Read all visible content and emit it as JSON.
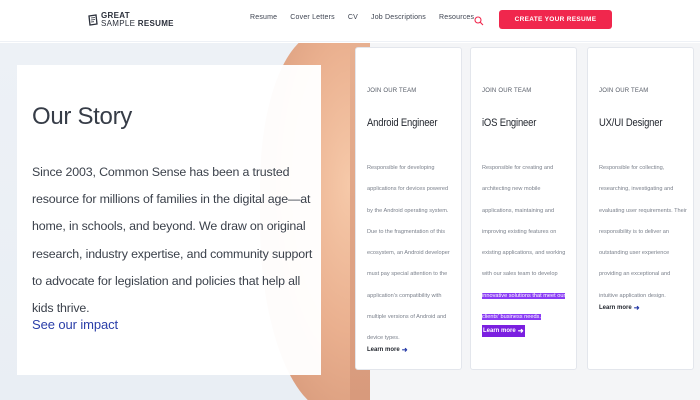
{
  "header": {
    "logo": {
      "line1": "GREAT",
      "line2_a": "SAMPLE ",
      "line2_b": "RESUME"
    },
    "nav": [
      "Resume",
      "Cover Letters",
      "CV",
      "Job Descriptions",
      "Resources"
    ],
    "search_icon": "search-icon",
    "cta_label": "CREATE YOUR RESUME",
    "accent": "#f0274d"
  },
  "story": {
    "title": "Our Story",
    "body": "Since 2003, Common Sense has been a trusted resource for millions of families in the digital age—at home, in schools, and beyond. We draw on original research, industry expertise, and community support to advocate for legislation and policies that help all kids thrive.",
    "link": "See our impact"
  },
  "jobs": [
    {
      "eyebrow": "JOIN OUR TEAM",
      "title": "Android Engineer",
      "desc": "Responsible for developing applications for devices powered by the Android operating system. Due to the fragmentation of this ecosystem, an Android developer must pay special attention to the application's compatibility with multiple versions of Android and device types.",
      "link": "Learn more"
    },
    {
      "eyebrow": "JOIN OUR TEAM",
      "title": "iOS Engineer",
      "desc_plain": "Responsible for creating and architecting new mobile applications, maintaining and improving existing features on existing applications, and working with our sales team to develop ",
      "desc_highlight": "innovative solutions that meet our clients' business needs.",
      "link": "Learn more"
    },
    {
      "eyebrow": "JOIN OUR TEAM",
      "title": "UX/UI Designer",
      "desc": "Responsible for collecting, researching, investigating and evaluating user requirements. Their responsibility is to deliver an outstanding user experience providing an exceptional and intuitive application design.",
      "link": "Learn more"
    }
  ]
}
